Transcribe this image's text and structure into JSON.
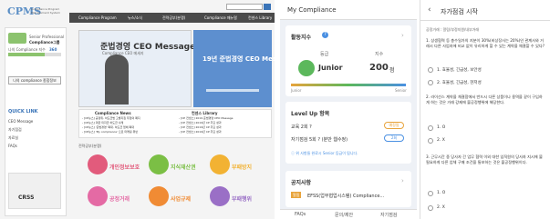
{
  "site": {
    "logo": "CPMS",
    "logo_sub": "Compliance Program Management System",
    "nav": [
      "Compliance Program",
      "뉴스/소식",
      "전략공부(분쟁)",
      "Compliance 매뉴얼",
      "컨센스 Library"
    ],
    "user_role": "Senior Professional",
    "user_name": "Compliance그룹",
    "compliance_label": "나의 Compliance 지수",
    "compliance_value": "360",
    "dropdown": "나의 compliance 종합정보",
    "quick_title": "QUICK LINK",
    "quick_links": [
      "CEO Message",
      "자기점검",
      "자료실",
      "FAQs"
    ],
    "banner_title": "준법경영 CEO Message",
    "banner_sub": "Compliance CEO 메세지",
    "banner2_title": "19년 준법경영 CEO Mes...",
    "news_title": "Compliance News",
    "library_title": "컨센스 Library",
    "news_items": [
      "- [CP뉴스] 공정위, 하도급법 고발지침 무혐의 폐지",
      "- [CP뉴스] 대금 미지급 하도급 사례",
      "- [CP뉴스] '준법경영' 확대, 하도급 업체 확대",
      "- [CP뉴스] 'My compliance' 으로 마케팅 위반"
    ],
    "library_items": [
      "- [CP 컨센스] 2019 준법경영 CEO Message",
      "- [CP 컨센스] 2019년 CP 주요 성과",
      "- [CP 컨센스] 2019년 CP 주요 성과",
      "- [CP 컨센스] 2019년 CP 주요 성과"
    ],
    "tag_label": "전략공부(분쟁)",
    "circles": [
      {
        "label": "개인정보보호",
        "color": "#e25b7c"
      },
      {
        "label": "지식재산권",
        "color": "#7bbf45"
      },
      {
        "label": "부패방지",
        "color": "#f2b233"
      },
      {
        "label": "공정거래",
        "color": "#e46aa4"
      },
      {
        "label": "사업규제",
        "color": "#f08b34"
      },
      {
        "label": "부패행위",
        "color": "#9a6fc6"
      }
    ],
    "crss": "CRSS"
  },
  "app1": {
    "title": "My Compliance",
    "index_label": "활동지수",
    "grade_label": "등급",
    "score_label": "지수",
    "grade": "Junior",
    "score": "200",
    "score_unit": "점",
    "scale_start": "Junior",
    "scale_end": "Senior",
    "level_up": "Level Up 항목",
    "item1": "교육 2회 ?",
    "item1_badge": "예정됨",
    "item2": "자기점검 5회 ? (분반 웹수정)",
    "item2_badge": "2회",
    "note": "ⓘ 위 사항들 완료시 Senior 등급이 됩니다.",
    "notice_title": "공지사항",
    "notice_badge": "알림",
    "notice_item": "EFSS(업무협업시스템) Compliance...",
    "tabs": [
      "FAQs",
      "문의/제안",
      "자기점검"
    ]
  },
  "app2": {
    "title": "자가점검 시작",
    "intro": "공정거래 : 알림/부정지원/내부거래",
    "questions": [
      {
        "text": "1. 상생협력 등 총수일가의 지분이 30%(비상장사는 20%)인 관계사와 거래시 다른 사업자에 비교 없이 유리하게 할 수 있는 계약을 체결할 수 있다?",
        "options": [
          "1. 효율성, 긴급성, 보안성",
          "2. 효율성, 긴급성, 현저성"
        ]
      },
      {
        "text": "2. 라이선스 계약을 체결함에서 반드시 다른 상품이나 용역을 같이 구입하게 하는 것은 거래 강제에 불공정행위에 해당한다.",
        "options": [
          "1. O",
          "2. X"
        ]
      },
      {
        "text": "3. 근무시간 중 당사자 간 업무 협력 이외 대한 임직원의 당사자 지시에 불필요하게 다른 업체 구매 조건을 통보하는 것은 불공정행위이다.",
        "options": [
          "1. O",
          "2. X"
        ]
      }
    ]
  }
}
